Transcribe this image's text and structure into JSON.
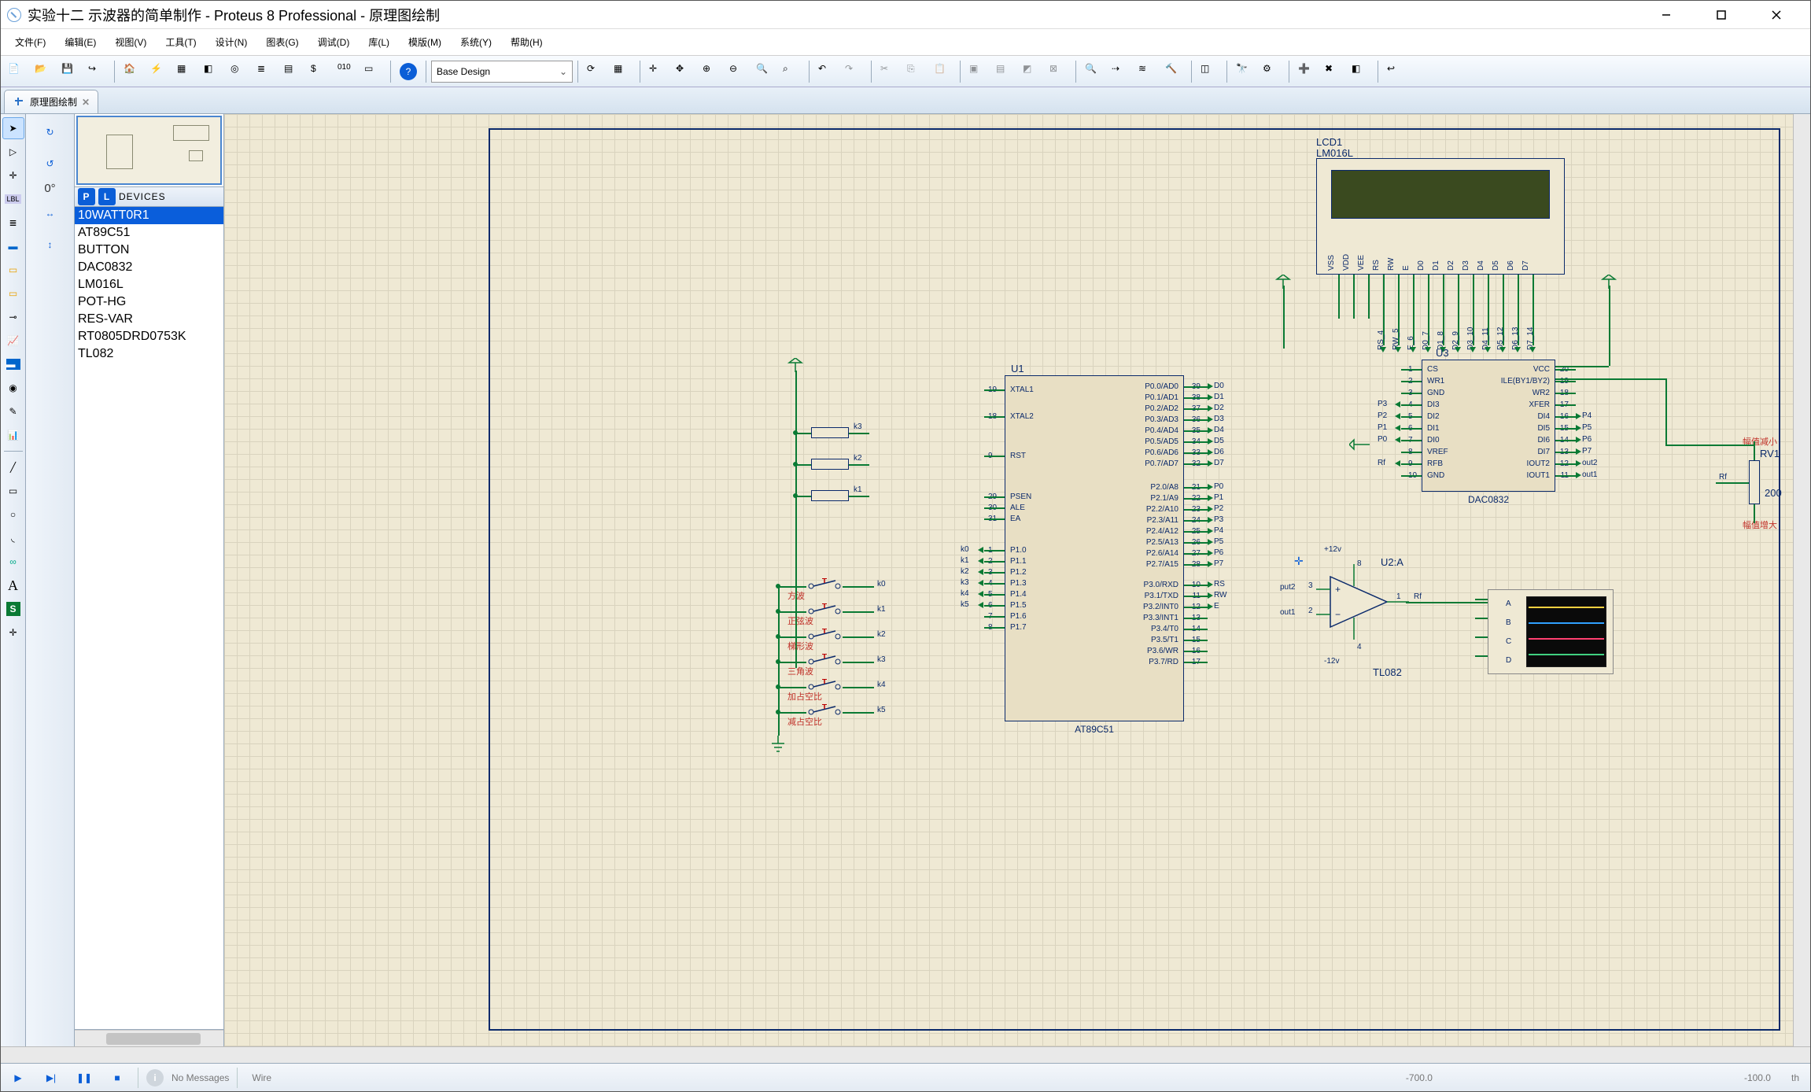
{
  "title": "实验十二 示波器的简单制作 - Proteus 8 Professional - 原理图绘制",
  "menus": [
    "文件(F)",
    "编辑(E)",
    "视图(V)",
    "工具(T)",
    "设计(N)",
    "图表(G)",
    "调试(D)",
    "库(L)",
    "模版(M)",
    "系统(Y)",
    "帮助(H)"
  ],
  "design_variant": "Base Design",
  "tab": {
    "label": "原理图绘制"
  },
  "rotation_label": "0°",
  "devices_header": "DEVICES",
  "devices": [
    "10WATT0R1",
    "AT89C51",
    "BUTTON",
    "DAC0832",
    "LM016L",
    "POT-HG",
    "RES-VAR",
    "RT0805DRD0753K",
    "TL082"
  ],
  "selected_device_index": 0,
  "status": {
    "messages": "No Messages",
    "mode": "Wire",
    "coord_x": "-700.0",
    "coord_y": "-100.0",
    "units": "th"
  },
  "schematic": {
    "u1": {
      "ref": "U1",
      "part": "AT89C51",
      "left_pins": [
        {
          "num": "19",
          "name": "XTAL1"
        },
        {
          "num": "18",
          "name": "XTAL2"
        },
        {
          "num": "9",
          "name": "RST"
        },
        {
          "num": "29",
          "name": "PSEN"
        },
        {
          "num": "30",
          "name": "ALE"
        },
        {
          "num": "31",
          "name": "EA"
        },
        {
          "num": "1",
          "name": "P1.0"
        },
        {
          "num": "2",
          "name": "P1.1"
        },
        {
          "num": "3",
          "name": "P1.2"
        },
        {
          "num": "4",
          "name": "P1.3"
        },
        {
          "num": "5",
          "name": "P1.4"
        },
        {
          "num": "6",
          "name": "P1.5"
        },
        {
          "num": "7",
          "name": "P1.6"
        },
        {
          "num": "8",
          "name": "P1.7"
        }
      ],
      "right_pins": [
        {
          "num": "39",
          "name": "P0.0/AD0"
        },
        {
          "num": "38",
          "name": "P0.1/AD1"
        },
        {
          "num": "37",
          "name": "P0.2/AD2"
        },
        {
          "num": "36",
          "name": "P0.3/AD3"
        },
        {
          "num": "35",
          "name": "P0.4/AD4"
        },
        {
          "num": "34",
          "name": "P0.5/AD5"
        },
        {
          "num": "33",
          "name": "P0.6/AD6"
        },
        {
          "num": "32",
          "name": "P0.7/AD7"
        },
        {
          "num": "21",
          "name": "P2.0/A8"
        },
        {
          "num": "22",
          "name": "P2.1/A9"
        },
        {
          "num": "23",
          "name": "P2.2/A10"
        },
        {
          "num": "24",
          "name": "P2.3/A11"
        },
        {
          "num": "25",
          "name": "P2.4/A12"
        },
        {
          "num": "26",
          "name": "P2.5/A13"
        },
        {
          "num": "27",
          "name": "P2.6/A14"
        },
        {
          "num": "28",
          "name": "P2.7/A15"
        },
        {
          "num": "10",
          "name": "P3.0/RXD"
        },
        {
          "num": "11",
          "name": "P3.1/TXD"
        },
        {
          "num": "12",
          "name": "P3.2/INT0"
        },
        {
          "num": "13",
          "name": "P3.3/INT1"
        },
        {
          "num": "14",
          "name": "P3.4/T0"
        },
        {
          "num": "15",
          "name": "P3.5/T1"
        },
        {
          "num": "16",
          "name": "P3.6/WR"
        },
        {
          "num": "17",
          "name": "P3.7/RD"
        }
      ]
    },
    "u3": {
      "ref": "U3",
      "part": "DAC0832",
      "left_pins": [
        {
          "num": "1",
          "name": "CS"
        },
        {
          "num": "2",
          "name": "WR1"
        },
        {
          "num": "3",
          "name": "GND"
        },
        {
          "num": "4",
          "name": "DI3"
        },
        {
          "num": "5",
          "name": "DI2"
        },
        {
          "num": "6",
          "name": "DI1"
        },
        {
          "num": "7",
          "name": "DI0"
        },
        {
          "num": "8",
          "name": "VREF"
        },
        {
          "num": "9",
          "name": "RFB"
        },
        {
          "num": "10",
          "name": "GND"
        }
      ],
      "right_pins": [
        {
          "num": "20",
          "name": "VCC"
        },
        {
          "num": "19",
          "name": "ILE(BY1/BY2)"
        },
        {
          "num": "18",
          "name": "WR2"
        },
        {
          "num": "17",
          "name": "XFER"
        },
        {
          "num": "16",
          "name": "DI4"
        },
        {
          "num": "15",
          "name": "DI5"
        },
        {
          "num": "14",
          "name": "DI6"
        },
        {
          "num": "13",
          "name": "DI7"
        },
        {
          "num": "12",
          "name": "IOUT2"
        },
        {
          "num": "11",
          "name": "IOUT1"
        }
      ]
    },
    "u2": {
      "ref": "U2:A",
      "part": "TL082",
      "plus": "+12v",
      "minus": "-12v",
      "in_p": "put2",
      "in_n": "out1",
      "in_p_num": "3",
      "in_n_num": "2",
      "out_num": "1",
      "vcc_num": "8",
      "vee_num": "4",
      "out_net": "Rf"
    },
    "lcd": {
      "ref": "LCD1",
      "part": "LM016L",
      "pins": [
        "VSS",
        "VDD",
        "VEE",
        "RS",
        "RW",
        "E",
        "D0",
        "D1",
        "D2",
        "D3",
        "D4",
        "D5",
        "D6",
        "D7"
      ],
      "nets": [
        "",
        "",
        "",
        "RS_4",
        "RW_5",
        "E_6",
        "D0_7",
        "D1_8",
        "D2_9",
        "D3_10",
        "D4_11",
        "D5_12",
        "D6_13",
        "D7_14"
      ]
    },
    "rv1": {
      "ref": "RV1",
      "value": "200",
      "net": "Rf",
      "label_top": "幅值减小",
      "label_bot": "幅值增大"
    },
    "buttons": {
      "nets": [
        "k0",
        "k1",
        "k2",
        "k3",
        "k4",
        "k5"
      ],
      "labels": [
        "方波",
        "正弦波",
        "梯形波",
        "三角波",
        "加占空比",
        "减占空比"
      ]
    },
    "resistors": {
      "r_labels": [
        "k3",
        "k2",
        "k1"
      ]
    },
    "p0_nets": [
      "D0",
      "D1",
      "D2",
      "D3",
      "D4",
      "D5",
      "D6",
      "D7"
    ],
    "p2_nets": [
      "P0",
      "P1",
      "P2",
      "P3",
      "P4",
      "P5",
      "P6",
      "P7"
    ],
    "p3_nets": [
      "RS",
      "RW",
      "E"
    ],
    "p1_in_nets": [
      "k0",
      "k1",
      "k2",
      "k3",
      "k4",
      "k5"
    ],
    "dac_left_nets": [
      "",
      "",
      "",
      "P3",
      "P2",
      "P1",
      "P0",
      "",
      "Rf",
      ""
    ],
    "dac_right_nets": [
      "",
      "",
      "",
      "",
      "P4",
      "P5",
      "P6",
      "P7",
      "out2",
      "out1"
    ],
    "scope": {
      "channels": [
        "A",
        "B",
        "C",
        "D"
      ]
    }
  }
}
